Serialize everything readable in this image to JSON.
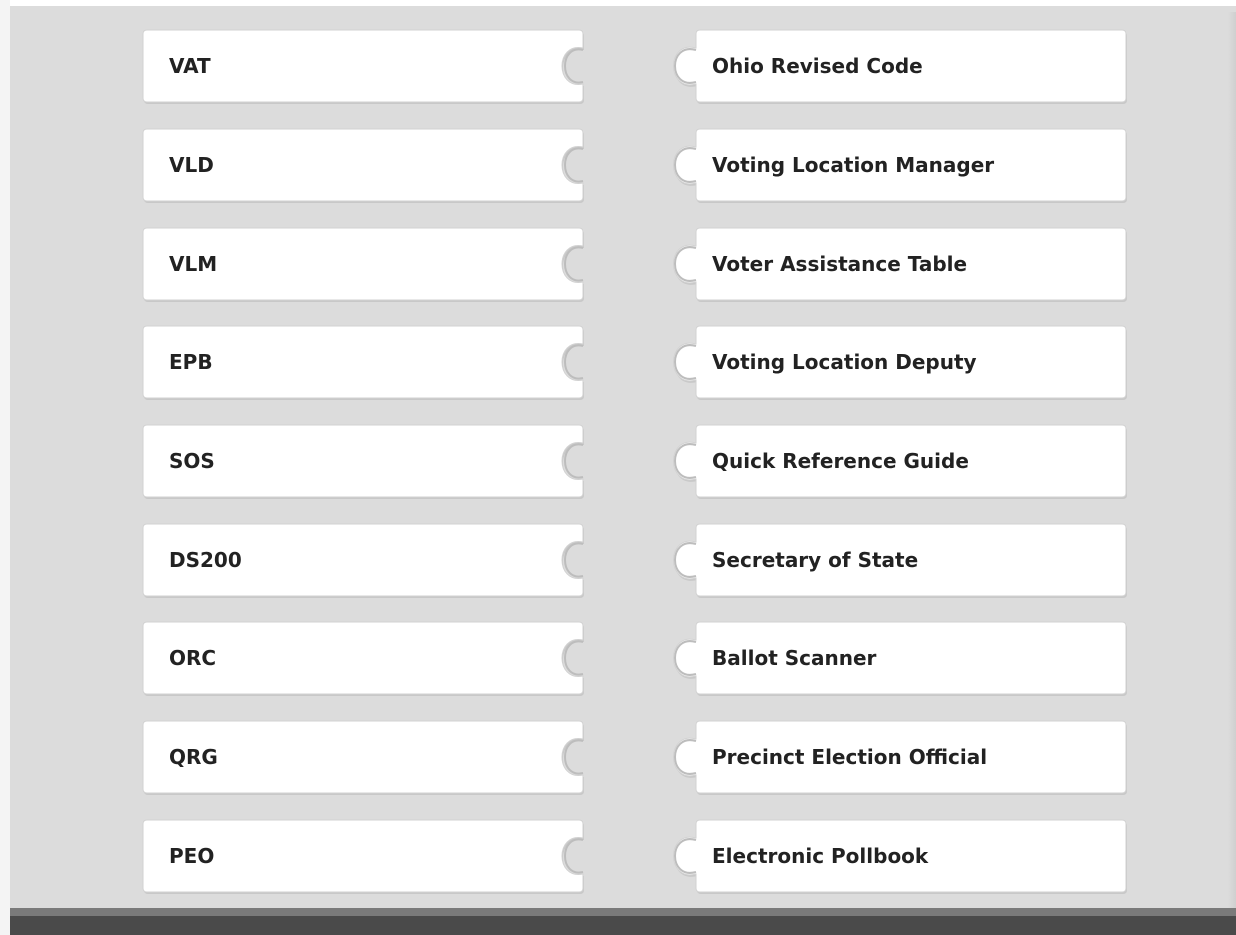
{
  "matching": {
    "terms": [
      {
        "label": "VAT"
      },
      {
        "label": "VLD"
      },
      {
        "label": "VLM"
      },
      {
        "label": "EPB"
      },
      {
        "label": "SOS"
      },
      {
        "label": "DS200"
      },
      {
        "label": "ORC"
      },
      {
        "label": "QRG"
      },
      {
        "label": "PEO"
      }
    ],
    "definitions": [
      {
        "label": "Ohio Revised Code"
      },
      {
        "label": "Voting Location Manager"
      },
      {
        "label": "Voter Assistance Table"
      },
      {
        "label": "Voting Location Deputy"
      },
      {
        "label": "Quick Reference Guide"
      },
      {
        "label": "Secretary of State"
      },
      {
        "label": "Ballot Scanner"
      },
      {
        "label": "Precinct Election Official"
      },
      {
        "label": "Electronic Pollbook"
      }
    ]
  },
  "colors": {
    "panel": "#dcdcdc",
    "tile": "#ffffff",
    "text": "#222222",
    "bottom_bar": "#4a4a4a"
  }
}
